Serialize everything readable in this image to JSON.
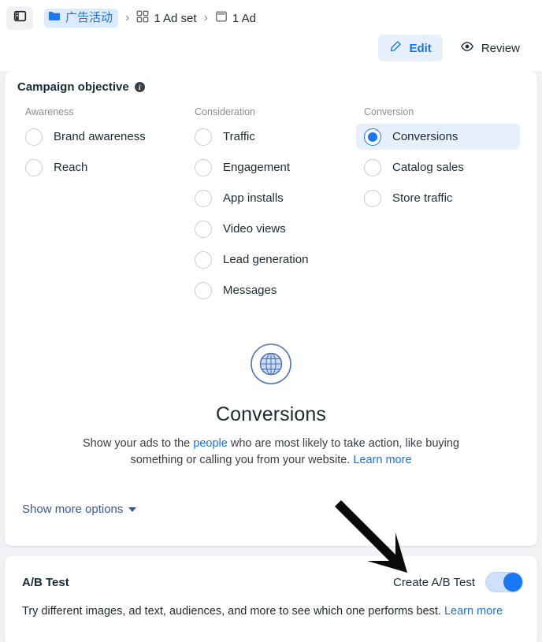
{
  "topbar": {
    "panel_icon": "sidebar-panel-icon",
    "breadcrumb": [
      {
        "icon": "folder-icon",
        "label": "广告活动",
        "active": true
      },
      {
        "icon": "grid-icon",
        "label": "1 Ad set",
        "active": false
      },
      {
        "icon": "ad-frame-icon",
        "label": "1 Ad",
        "active": false
      }
    ],
    "separator": "›",
    "actions": [
      {
        "icon": "pencil-icon",
        "label": "Edit",
        "primary": true
      },
      {
        "icon": "eye-icon",
        "label": "Review",
        "primary": false
      }
    ]
  },
  "objective": {
    "title": "Campaign objective",
    "info_icon": "info-icon",
    "columns": [
      {
        "heading": "Awareness",
        "options": [
          {
            "label": "Brand awareness",
            "selected": false
          },
          {
            "label": "Reach",
            "selected": false
          }
        ]
      },
      {
        "heading": "Consideration",
        "options": [
          {
            "label": "Traffic",
            "selected": false
          },
          {
            "label": "Engagement",
            "selected": false
          },
          {
            "label": "App installs",
            "selected": false
          },
          {
            "label": "Video views",
            "selected": false
          },
          {
            "label": "Lead generation",
            "selected": false
          },
          {
            "label": "Messages",
            "selected": false
          }
        ]
      },
      {
        "heading": "Conversion",
        "options": [
          {
            "label": "Conversions",
            "selected": true
          },
          {
            "label": "Catalog sales",
            "selected": false
          },
          {
            "label": "Store traffic",
            "selected": false
          }
        ]
      }
    ],
    "hero": {
      "icon": "globe-icon",
      "title": "Conversions",
      "desc_part1": "Show your ads to the ",
      "desc_link1": "people",
      "desc_part2": " who are most likely to take action, like buying something or calling you from your website. ",
      "desc_link2": "Learn more"
    },
    "show_more": {
      "label": "Show more options",
      "icon": "chevron-down-icon"
    }
  },
  "ab_test": {
    "title": "A/B Test",
    "toggle_label": "Create A/B Test",
    "toggle_on": true,
    "desc_text": "Try different images, ad text, audiences, and more to see which one performs best. ",
    "desc_link": "Learn more"
  },
  "overlay": {
    "arrow_icon": "pointer-arrow-icon"
  },
  "colors": {
    "accent": "#1877f2",
    "link": "#1b74e4",
    "selected_bg": "#e7f0fd",
    "page_bg": "#f0f2f5",
    "card_bg": "#ffffff",
    "text": "#1c2b33",
    "muted": "#8a8d91"
  }
}
